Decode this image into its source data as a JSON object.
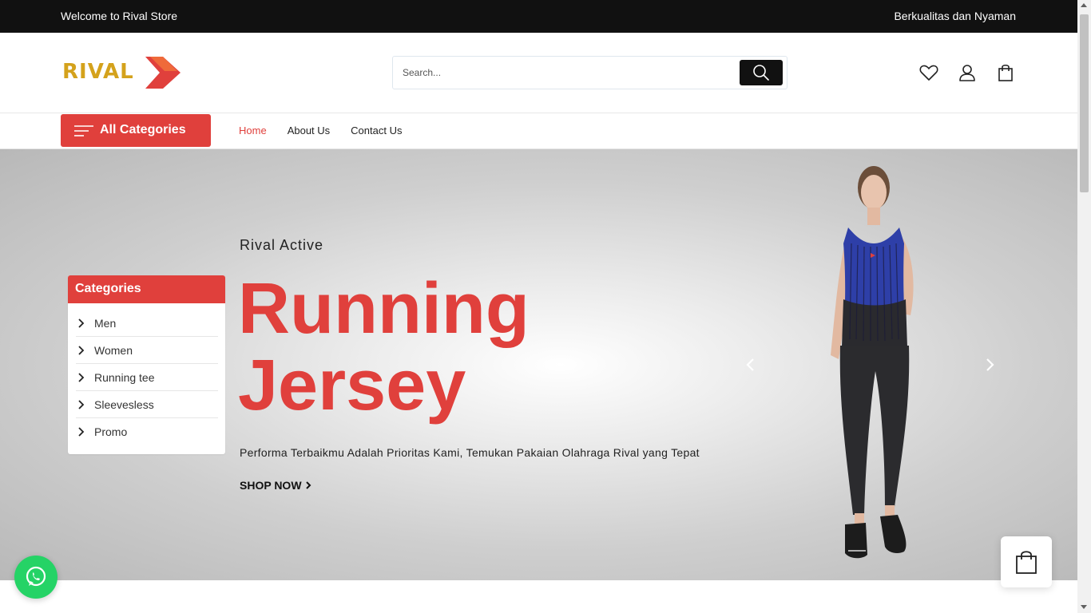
{
  "topbar": {
    "welcome": "Welcome to Rival Store",
    "tagline": "Berkualitas dan Nyaman"
  },
  "header": {
    "logo_text": "RIVAL",
    "search": {
      "placeholder": "Search...",
      "value": ""
    },
    "icons": [
      "search-icon",
      "heart-icon",
      "user-icon",
      "shopping-bag-icon"
    ]
  },
  "nav": {
    "all_categories": "All Categories",
    "links": [
      {
        "label": "Home",
        "active": true
      },
      {
        "label": "About Us",
        "active": false
      },
      {
        "label": "Contact Us",
        "active": false
      }
    ]
  },
  "sidebar": {
    "title": "Categories",
    "items": [
      {
        "label": "Men"
      },
      {
        "label": "Women"
      },
      {
        "label": "Running tee"
      },
      {
        "label": "Sleevesless"
      },
      {
        "label": "Promo"
      }
    ]
  },
  "hero": {
    "subtitle": "Rival Active",
    "title_line1": "Running",
    "title_line2": "Jersey",
    "description": "Performa Terbaikmu Adalah Prioritas Kami, Temukan Pakaian Olahraga Rival yang Tepat",
    "cta": "SHOP NOW"
  },
  "colors": {
    "accent": "#e0403c",
    "logo_gold": "#d4a21c",
    "topbar_bg": "#111111",
    "whatsapp": "#25d366"
  }
}
